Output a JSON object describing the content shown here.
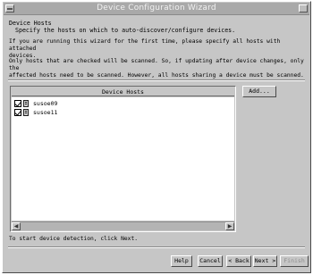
{
  "window": {
    "title": "Device Configuration Wizard"
  },
  "heading": "Device Hosts",
  "subheading": "Specify the hosts on which to auto-discover/configure devices.",
  "paragraph1": "If you are running this wizard for the first time, please specify all hosts with attached\ndevices.",
  "paragraph2": "Only hosts that are checked will be scanned.  So, if updating after device changes, only the\naffected hosts need to be scanned.  However, all hosts sharing a device must be scanned.",
  "host_list": {
    "header": "Device Hosts",
    "items": [
      {
        "label": "susoe09",
        "checked": true,
        "icon": "host-icon"
      },
      {
        "label": "susoe11",
        "checked": true,
        "icon": "host-icon"
      }
    ]
  },
  "buttons": {
    "add": "Add...",
    "help": "Help",
    "cancel": "Cancel",
    "back": "< Back",
    "next": "Next >",
    "finish": "Finish"
  },
  "footer_text": "To start device detection, click Next."
}
